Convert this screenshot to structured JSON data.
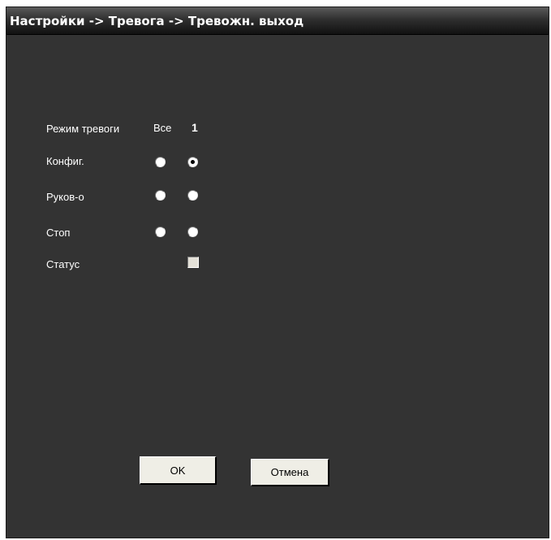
{
  "window": {
    "title": "Настройки -> Тревога -> Тревожн. выход"
  },
  "header_row": {
    "label": "Режим тревоги",
    "col_all": "Все",
    "col_one": "1"
  },
  "rows": [
    {
      "label": "Конфиг.",
      "all_selected": false,
      "one_selected": true
    },
    {
      "label": "Руков-о",
      "all_selected": false,
      "one_selected": false
    },
    {
      "label": "Стоп",
      "all_selected": false,
      "one_selected": false
    }
  ],
  "status": {
    "label": "Статус",
    "checked": false
  },
  "buttons": {
    "ok_label": "OK",
    "cancel_label": "Отмена"
  }
}
